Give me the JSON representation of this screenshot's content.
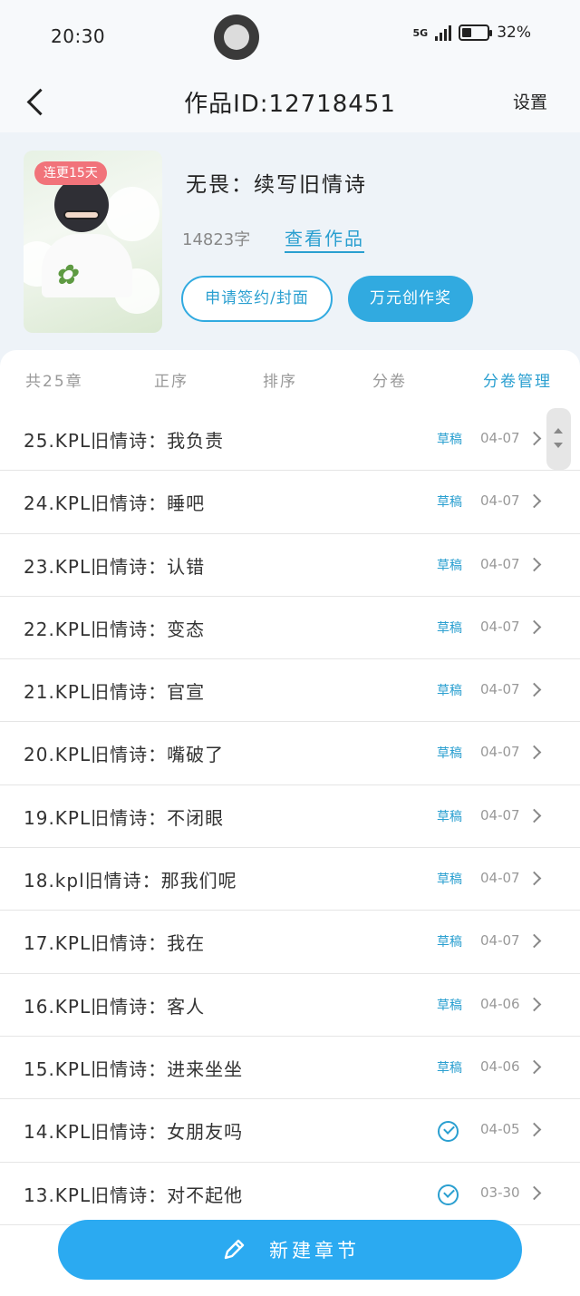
{
  "status_bar": {
    "time": "20:30",
    "network": "5G",
    "battery": "32%",
    "battery_level": 0.32
  },
  "nav": {
    "title": "作品ID:12718451",
    "settings_label": "设置",
    "back_icon": "chevron-left-icon"
  },
  "book": {
    "cover_badge": "连更15天",
    "title": "无畏：续写旧情诗",
    "word_count": "14823字",
    "view_work_label": "查看作品",
    "apply_button": "申请签约/封面",
    "award_button": "万元创作奖"
  },
  "tabs": {
    "count": "共25章",
    "order": "正序",
    "sort": "排序",
    "volume": "分卷",
    "volume_manage": "分卷管理"
  },
  "chapters": [
    {
      "title": "25.KPL旧情诗：我负责",
      "status": "草稿",
      "published": false,
      "date": "04-07"
    },
    {
      "title": "24.KPL旧情诗：睡吧",
      "status": "草稿",
      "published": false,
      "date": "04-07"
    },
    {
      "title": "23.KPL旧情诗：认错",
      "status": "草稿",
      "published": false,
      "date": "04-07"
    },
    {
      "title": "22.KPL旧情诗：变态",
      "status": "草稿",
      "published": false,
      "date": "04-07"
    },
    {
      "title": "21.KPL旧情诗：官宣",
      "status": "草稿",
      "published": false,
      "date": "04-07"
    },
    {
      "title": "20.KPL旧情诗：嘴破了",
      "status": "草稿",
      "published": false,
      "date": "04-07"
    },
    {
      "title": "19.KPL旧情诗：不闭眼",
      "status": "草稿",
      "published": false,
      "date": "04-07"
    },
    {
      "title": "18.kpl旧情诗：那我们呢",
      "status": "草稿",
      "published": false,
      "date": "04-07"
    },
    {
      "title": "17.KPL旧情诗：我在",
      "status": "草稿",
      "published": false,
      "date": "04-07"
    },
    {
      "title": "16.KPL旧情诗：客人",
      "status": "草稿",
      "published": false,
      "date": "04-06"
    },
    {
      "title": "15.KPL旧情诗：进来坐坐",
      "status": "草稿",
      "published": false,
      "date": "04-06"
    },
    {
      "title": "14.KPL旧情诗：女朋友吗",
      "status": "",
      "published": true,
      "date": "04-05"
    },
    {
      "title": "13.KPL旧情诗：对不起他",
      "status": "",
      "published": true,
      "date": "03-30"
    }
  ],
  "new_chapter_button": "新建章节",
  "colors": {
    "accent": "#2a9fd0",
    "button_fill": "#2baaf1",
    "badge": "#f1737a"
  }
}
